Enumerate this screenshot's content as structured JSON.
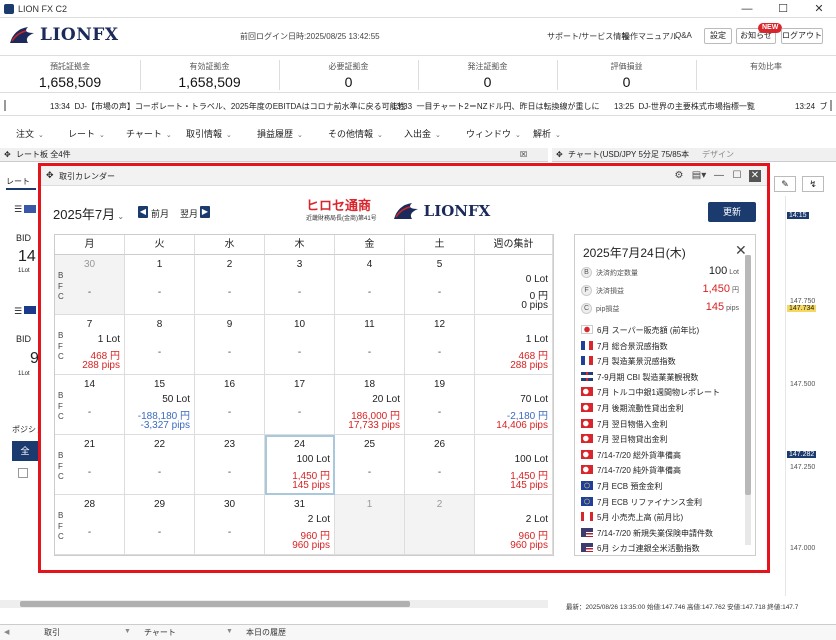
{
  "app": {
    "title": "LION FX C2"
  },
  "header": {
    "logo_text": "LIONFX",
    "last_login": "前回ログイン日時:2025/08/25 13:42:55",
    "links": [
      "サポート/サービス情報",
      "操作マニュアル",
      "Q&A"
    ],
    "buttons": {
      "settings": "設定",
      "news": "お知らせ",
      "logout": "ログアウト"
    },
    "news_badge": "NEW"
  },
  "summary": [
    {
      "label": "預託証拠金",
      "value": "1,658,509"
    },
    {
      "label": "有効証拠金",
      "value": "1,658,509"
    },
    {
      "label": "必要証拠金",
      "value": "0"
    },
    {
      "label": "発注証拠金",
      "value": "0"
    },
    {
      "label": "評価損益",
      "value": "0"
    },
    {
      "label": "有効比率",
      "value": ""
    }
  ],
  "ticker": [
    {
      "time": "13:34",
      "text": "DJ-【市場の声】コーポレート・トラベル、2025年度のEBITDAはコロナ前水準に戻る可能性"
    },
    {
      "time": "13:33",
      "text": "一目チャート2＝NZドル円、昨日は転換線が重しに"
    },
    {
      "time": "13:25",
      "text": "DJ-世界の主要株式市場指標一覧"
    },
    {
      "time": "13:24",
      "text": "ブ"
    }
  ],
  "menu": [
    "注文",
    "レート",
    "チャート",
    "取引情報",
    "損益履歴",
    "その他情報",
    "入出金",
    "ウィンドウ",
    "解析"
  ],
  "background": {
    "rate_panel_title": "レート板 全4件",
    "rate_tab": "レート",
    "bid_label": "BID",
    "bid_value_1": "14",
    "bid_value_2": "9",
    "lot_label": "1Lot",
    "position_tab": "ポジション",
    "all_button": "全",
    "chart_title": "チャート(USD/JPY 5分足 75/85本",
    "chart_design": "デザイン",
    "price_labels": [
      "14:15",
      "147.750",
      "147.734",
      "147.500",
      "147.282",
      "147.250",
      "147.000"
    ],
    "chart_footer": "最新：2025/08/26 13:35:00 始値:147.746 高値:147.762 安値:147.718 終値:147.7"
  },
  "dialog": {
    "title": "取引カレンダー",
    "month": "2025年7月",
    "prev": "前月",
    "next": "翌月",
    "refresh": "更新",
    "brand_hirose": "ヒロセ通商",
    "brand_sub": "近畿財務局長(金商)第41号",
    "brand_lion": "LIONFX",
    "weekdays": [
      "月",
      "火",
      "水",
      "木",
      "金",
      "土",
      "週の集計"
    ],
    "bfc": [
      "B",
      "F",
      "C"
    ],
    "dash": "-",
    "weeks": [
      [
        {
          "d": "30",
          "out": true,
          "gray": true
        },
        {
          "d": "1"
        },
        {
          "d": "2"
        },
        {
          "d": "3"
        },
        {
          "d": "4"
        },
        {
          "d": "5"
        },
        {
          "total": true,
          "lot": "0 Lot",
          "yen": "0 円",
          "pips": "0 pips",
          "yc": "black",
          "pc": "black"
        }
      ],
      [
        {
          "d": "7",
          "lot": "1 Lot",
          "yen": "468 円",
          "pips": "288 pips",
          "yc": "red",
          "pc": "red"
        },
        {
          "d": "8"
        },
        {
          "d": "9"
        },
        {
          "d": "10"
        },
        {
          "d": "11"
        },
        {
          "d": "12"
        },
        {
          "total": true,
          "lot": "1 Lot",
          "yen": "468 円",
          "pips": "288 pips",
          "yc": "red",
          "pc": "red"
        }
      ],
      [
        {
          "d": "14"
        },
        {
          "d": "15",
          "lot": "50 Lot",
          "yen": "-188,180 円",
          "pips": "-3,327 pips",
          "yc": "blue",
          "pc": "blue"
        },
        {
          "d": "16"
        },
        {
          "d": "17"
        },
        {
          "d": "18",
          "lot": "20 Lot",
          "yen": "186,000 円",
          "pips": "17,733 pips",
          "yc": "red",
          "pc": "red"
        },
        {
          "d": "19"
        },
        {
          "total": true,
          "lot": "70 Lot",
          "yen": "-2,180 円",
          "pips": "14,406 pips",
          "yc": "blue",
          "pc": "red"
        }
      ],
      [
        {
          "d": "21"
        },
        {
          "d": "22"
        },
        {
          "d": "23"
        },
        {
          "d": "24",
          "sel": true,
          "lot": "100 Lot",
          "yen": "1,450 円",
          "pips": "145 pips",
          "yc": "red",
          "pc": "red"
        },
        {
          "d": "25"
        },
        {
          "d": "26"
        },
        {
          "total": true,
          "lot": "100 Lot",
          "yen": "1,450 円",
          "pips": "145 pips",
          "yc": "red",
          "pc": "red"
        }
      ],
      [
        {
          "d": "28"
        },
        {
          "d": "29"
        },
        {
          "d": "30"
        },
        {
          "d": "31",
          "lot": "2 Lot",
          "yen": "960 円",
          "pips": "960 pips",
          "yc": "red",
          "pc": "red"
        },
        {
          "d": "1",
          "out": true,
          "gray": true,
          "nodash": true
        },
        {
          "d": "2",
          "out": true,
          "gray": true,
          "nodash": true
        },
        {
          "total": true,
          "lot": "2 Lot",
          "yen": "960 円",
          "pips": "960 pips",
          "yc": "red",
          "pc": "red"
        }
      ]
    ],
    "detail": {
      "title": "2025年7月24日(木)",
      "rows": [
        {
          "c": "B",
          "label": "決済約定数量",
          "value": "100",
          "unit": "Lot",
          "color": "#222"
        },
        {
          "c": "F",
          "label": "決済損益",
          "value": "1,450",
          "unit": "円",
          "color": "#d82222"
        },
        {
          "c": "C",
          "label": "pip損益",
          "value": "145",
          "unit": "pips",
          "color": "#d82222"
        }
      ],
      "events": [
        {
          "flag": "jp",
          "text": "6月 スーパー販売額 (前年比)"
        },
        {
          "flag": "fr",
          "text": "7月 総合景況感指数"
        },
        {
          "flag": "fr",
          "text": "7月 製造業景況感指数"
        },
        {
          "flag": "gb",
          "text": "7-9月期 CBI 製造業業観視数"
        },
        {
          "flag": "tr",
          "text": "7月 トルコ中銀1週間物レポレート"
        },
        {
          "flag": "tr",
          "text": "7月 後期流動性貸出金利"
        },
        {
          "flag": "tr",
          "text": "7月 翌日物借入金利"
        },
        {
          "flag": "tr",
          "text": "7月 翌日物貸出金利"
        },
        {
          "flag": "tr",
          "text": "7/14-7/20 総外貨準備高"
        },
        {
          "flag": "tr",
          "text": "7/14-7/20 純外貨準備高"
        },
        {
          "flag": "eu",
          "text": "7月 ECB 預金金利"
        },
        {
          "flag": "eu",
          "text": "7月 ECB リファイナンス金利"
        },
        {
          "flag": "ca",
          "text": "5月 小売売上高 (前月比)"
        },
        {
          "flag": "us",
          "text": "7/14-7/20 新規失業保険申請件数"
        },
        {
          "flag": "us",
          "text": "6月 シカゴ連銀全米活動指数"
        }
      ]
    }
  },
  "bottom_tabs": [
    "取引",
    "チャート",
    "本日の履歴"
  ],
  "colors": {
    "accent": "#1b3b6f",
    "highlight": "#e4141c",
    "profit": "#d82222",
    "loss": "#3a6bbf"
  }
}
